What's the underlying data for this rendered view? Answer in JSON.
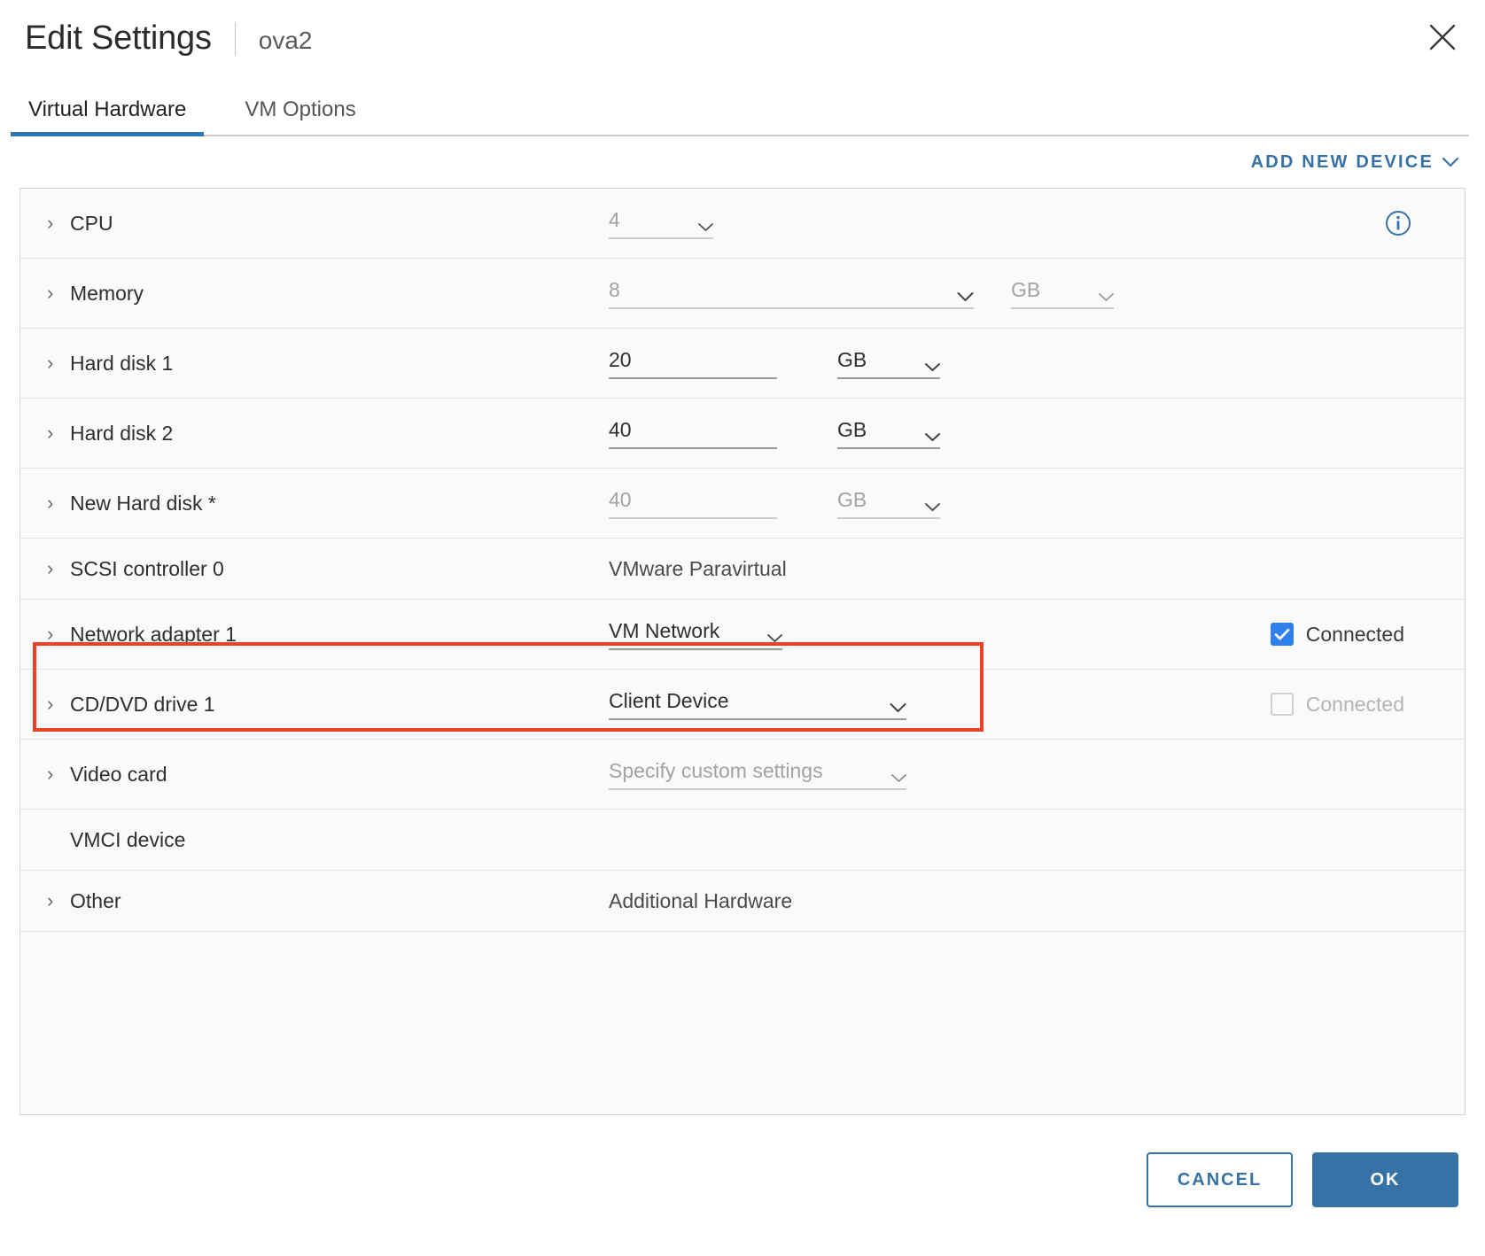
{
  "header": {
    "title": "Edit Settings",
    "subtitle": "ova2",
    "close_label": "Close"
  },
  "tabs": [
    {
      "label": "Virtual Hardware",
      "active": true
    },
    {
      "label": "VM Options",
      "active": false
    }
  ],
  "toolbar": {
    "add_new_device": "ADD NEW DEVICE"
  },
  "colors": {
    "accent": "#3672a5",
    "tab_underline": "#2d78b4",
    "checkbox_checked": "#2f80ed",
    "highlight": "#eb4126",
    "panel_bg": "#fafafa"
  },
  "devices": [
    {
      "label": "CPU",
      "value": "4",
      "unit": "",
      "info_icon": true
    },
    {
      "label": "Memory",
      "value": "8",
      "unit": "GB"
    },
    {
      "label": "Hard disk 1",
      "value": "20",
      "unit": "GB"
    },
    {
      "label": "Hard disk 2",
      "value": "40",
      "unit": "GB"
    },
    {
      "label": "New Hard disk *",
      "value": "40",
      "unit": "GB",
      "highlighted": true
    },
    {
      "label": "SCSI controller 0",
      "value": "VMware Paravirtual"
    },
    {
      "label": "Network adapter 1",
      "value": "VM Network",
      "connected_label": "Connected",
      "connected": true
    },
    {
      "label": "CD/DVD drive 1",
      "value": "Client Device",
      "connected_label": "Connected",
      "connected": false
    },
    {
      "label": "Video card",
      "value": "Specify custom settings"
    },
    {
      "label": "VMCI device",
      "value": ""
    },
    {
      "label": "Other",
      "value": "Additional Hardware"
    }
  ],
  "footer": {
    "cancel_label": "CANCEL",
    "ok_label": "OK"
  }
}
